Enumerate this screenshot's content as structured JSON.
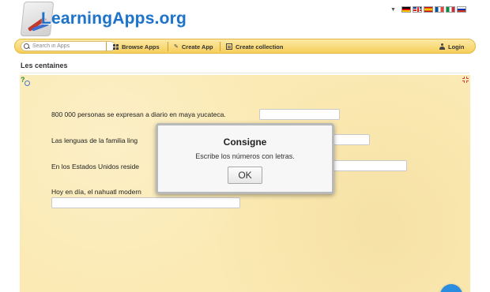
{
  "header": {
    "logo_text": "LearningApps.org",
    "languages": [
      "de",
      "en",
      "es",
      "fr",
      "it",
      "ru"
    ]
  },
  "navbar": {
    "search_placeholder": "Search in Apps",
    "browse_label": "Browse Apps",
    "create_label": "Create App",
    "collection_label": "Create collection",
    "login_label": "Login"
  },
  "app": {
    "title": "Les centaines",
    "questions": [
      {
        "text": "800 000 personas se expresan a diario en maya yucateca.",
        "answer": ""
      },
      {
        "text": "Las lenguas de la familia ling",
        "answer": ""
      },
      {
        "text": "En los Estados Unidos reside",
        "answer": ""
      },
      {
        "text": "Hoy en día, el nahuatl modern",
        "answer": ""
      }
    ]
  },
  "modal": {
    "title": "Consigne",
    "message": "Escribe los números con letras.",
    "ok_label": "OK"
  },
  "colors": {
    "app_background": "#fbeab4",
    "navbar": "#f6cf5b",
    "logo": "#1e72c8",
    "fab": "#2a8de0"
  }
}
